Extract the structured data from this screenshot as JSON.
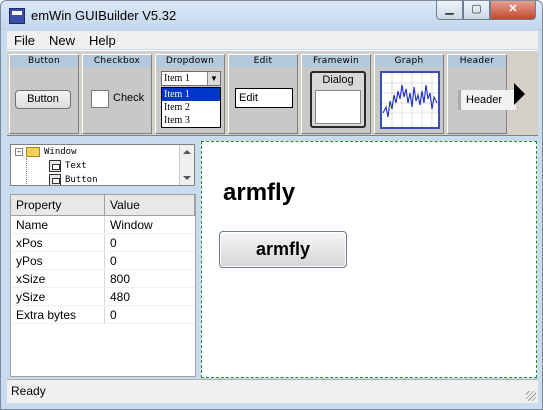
{
  "window": {
    "title": "emWin GUIBuilder V5.32",
    "min_glyph": "▁",
    "max_glyph": "▢",
    "close_glyph": "✕"
  },
  "menu": [
    "File",
    "New",
    "Help"
  ],
  "palette": {
    "button": {
      "header": "Button",
      "label": "Button"
    },
    "checkbox": {
      "header": "Checkbox",
      "label": "Check"
    },
    "dropdown": {
      "header": "Dropdown",
      "selected": "Item 1",
      "items": [
        "Item 1",
        "Item 2",
        "Item 3"
      ],
      "arrow_glyph": "▼"
    },
    "edit": {
      "header": "Edit",
      "value": "Edit"
    },
    "framewin": {
      "header": "Framewin",
      "title": "Dialog"
    },
    "graph": {
      "header": "Graph"
    },
    "header": {
      "header": "Header",
      "label": "Header"
    }
  },
  "tree": {
    "items": [
      "Window",
      "Text",
      "Button"
    ]
  },
  "properties": {
    "columns": [
      "Property",
      "Value"
    ],
    "rows": [
      [
        "Name",
        "Window"
      ],
      [
        "xPos",
        "0"
      ],
      [
        "yPos",
        "0"
      ],
      [
        "xSize",
        "800"
      ],
      [
        "ySize",
        "480"
      ],
      [
        "Extra bytes",
        "0"
      ]
    ]
  },
  "canvas": {
    "text_label": "armfly",
    "button_label": "armfly"
  },
  "status": {
    "text": "Ready"
  },
  "colors": {
    "selection": "#0037c8",
    "canvas_border": "#2a8a2a",
    "graph_line": "#1e2ec8"
  }
}
